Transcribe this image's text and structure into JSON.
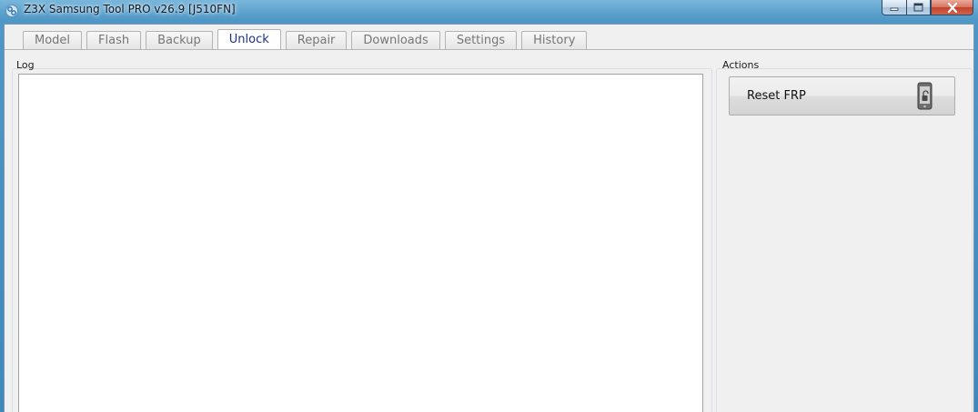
{
  "window": {
    "title": "Z3X Samsung Tool PRO v26.9 [J510FN]",
    "icon": "z3x-app-icon",
    "controls": [
      "minimize",
      "maximize",
      "close"
    ]
  },
  "tabs": [
    {
      "label": "Model",
      "active": false
    },
    {
      "label": "Flash",
      "active": false
    },
    {
      "label": "Backup",
      "active": false
    },
    {
      "label": "Unlock",
      "active": true
    },
    {
      "label": "Repair",
      "active": false
    },
    {
      "label": "Downloads",
      "active": false
    },
    {
      "label": "Settings",
      "active": false
    },
    {
      "label": "History",
      "active": false
    }
  ],
  "log": {
    "label": "Log",
    "content": ""
  },
  "actions": {
    "label": "Actions",
    "buttons": [
      {
        "label": "Reset FRP",
        "icon": "phone-unlock-icon"
      }
    ]
  },
  "colors": {
    "active_tab_text": "#1d2f8a",
    "inactive_tab_text": "#767676",
    "window_frame": "#4e97c6"
  }
}
